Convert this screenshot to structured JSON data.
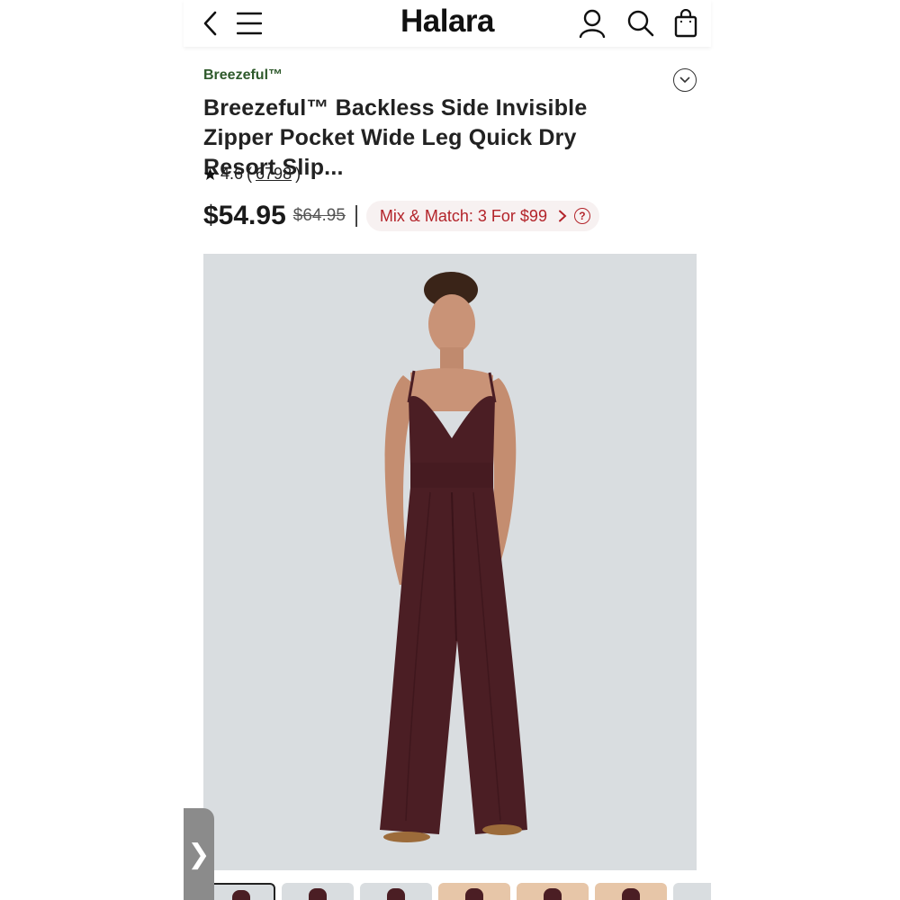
{
  "header": {
    "logo": "Halara",
    "icons": [
      "back-icon",
      "menu-icon",
      "account-icon",
      "search-icon",
      "bag-icon"
    ]
  },
  "product": {
    "brand": "Breezeful™",
    "title": "Breezeful™ Backless Side Invisible Zipper Pocket Wide Leg Quick Dry Resort Slip...",
    "rating": "4.6",
    "rating_open": "(",
    "review_count": "6798",
    "rating_close": ")",
    "price": "$54.95",
    "original_price": "$64.95",
    "promo_label": "Mix & Match: 3 For $99",
    "help_glyph": "?"
  },
  "side_handle": {
    "glyph": "❯"
  },
  "colors": {
    "brand_green": "#2f5a2c",
    "promo_red": "#b3242a",
    "garment": "#4b1e24",
    "photo_bg": "#d9dde0"
  },
  "gallery": {
    "thumb_count": 7,
    "active_index": 0
  }
}
